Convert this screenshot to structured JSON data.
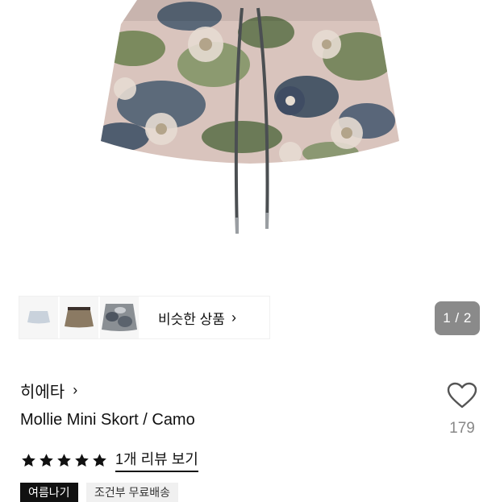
{
  "similar": {
    "label": "비슷한 상품",
    "chevron_icon": "chevron-right-icon",
    "thumbnails": [
      "light-skirt-thumbnail",
      "brown-skirt-thumbnail",
      "camo-skirt-thumbnail"
    ]
  },
  "gallery": {
    "pager_text": "1 / 2",
    "image_icon": "camo-mini-skort-photo"
  },
  "product": {
    "brand": "히에타",
    "brand_chevron_icon": "chevron-right-icon",
    "name": "Mollie Mini Skort / Camo",
    "like_icon": "heart-outline-icon",
    "like_count": "179",
    "rating_stars": 5,
    "review_link": "1개 리뷰 보기",
    "badges": {
      "season": "여름나기",
      "shipping": "조건부 무료배송"
    }
  },
  "colors": {
    "pager_bg": "#8a8a8a",
    "badge_dark": "#111111",
    "badge_light": "#f0f0f0",
    "like_count": "#888888"
  }
}
